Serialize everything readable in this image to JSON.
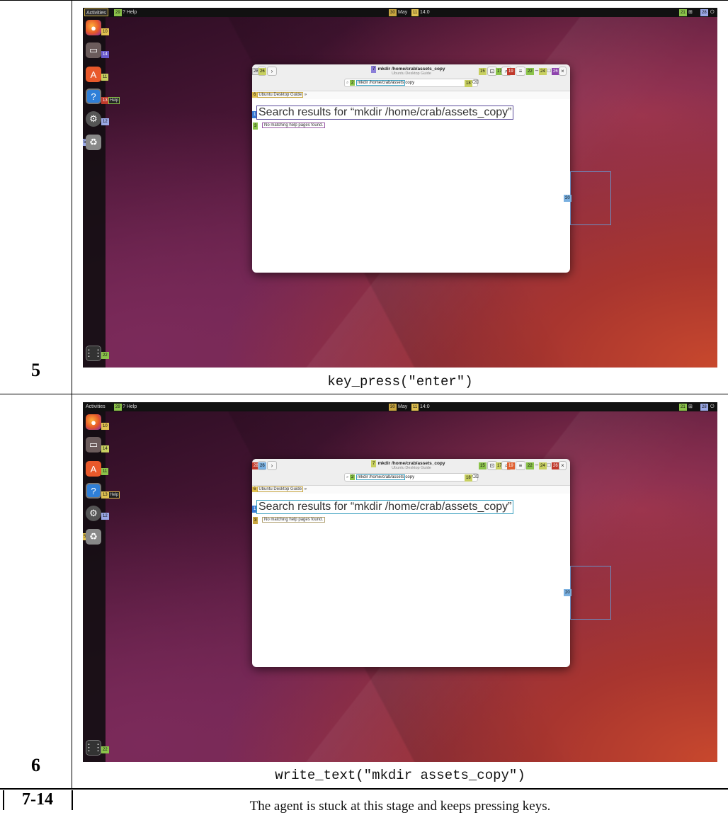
{
  "rows": [
    {
      "step": "5",
      "action": "key_press(\"enter\")",
      "screen": {
        "topbar": {
          "activities": "Activities",
          "help": "Help",
          "clock_day": "May",
          "clock_time": "14:0",
          "tag_a": "29",
          "tag_date": "30",
          "tag_time": "11",
          "tag_r1": "21",
          "tag_r2": "28"
        },
        "dock_tags": [
          "10",
          "14",
          "11",
          "13",
          "12",
          "5",
          "22"
        ],
        "dock_help_label": "Help",
        "window": {
          "title": "mkdir /home/crab/assets_copy",
          "subtitle": "Ubuntu Desktop Guide",
          "search_value": "mkdir /home/crab/assets",
          "search_suffix": "copy",
          "breadcrumb": "Ubuntu Desktop Guide",
          "results_title": "Search results for “mkdir /home/crab/assets_copy”",
          "results_count": "No",
          "results_text": "matching help pages found.",
          "tag_back": "28",
          "tag_fwd": "26",
          "tag_title": "7",
          "tag_search": "2",
          "tag_clear": "18",
          "tag_crumb": "6",
          "tag_res": "1",
          "tag_sub": "3",
          "tag_bm": "15",
          "tag_find": "17",
          "tag_menu": "19",
          "tag_min": "22",
          "tag_max": "24",
          "tag_close": "26"
        },
        "ghost_tag": "20"
      }
    },
    {
      "step": "6",
      "action": "write_text(\"mkdir assets_copy\")",
      "screen": {
        "topbar": {
          "activities": "Activities",
          "help": "Help",
          "clock_day": "May",
          "clock_time": "14:0",
          "tag_a": "29",
          "tag_date": "30",
          "tag_time": "11",
          "tag_r1": "21",
          "tag_r2": "28"
        },
        "dock_tags": [
          "10",
          "14",
          "11",
          "13",
          "12",
          "5",
          "22"
        ],
        "dock_help_label": "Help",
        "window": {
          "title": "mkdir /home/crab/assets_copy",
          "subtitle": "Ubuntu Desktop Guide",
          "search_value": "mkdir /home/crab/assets",
          "search_suffix": "copy",
          "breadcrumb": "Ubuntu Desktop Guide",
          "results_title": "Search results for “mkdir /home/crab/assets_copy”",
          "results_count": "No",
          "results_text": "matching help pages found.",
          "tag_back": "28",
          "tag_fwd": "26",
          "tag_title": "7",
          "tag_search": "2",
          "tag_clear": "18",
          "tag_crumb": "6",
          "tag_res": "1",
          "tag_sub": "3",
          "tag_bm": "15",
          "tag_find": "17",
          "tag_menu": "19",
          "tag_min": "22",
          "tag_max": "24",
          "tag_close": "26"
        },
        "ghost_tag": "20"
      }
    }
  ],
  "footer": {
    "step": "7-14",
    "note": "The agent is stuck at this stage and keeps pressing keys."
  }
}
